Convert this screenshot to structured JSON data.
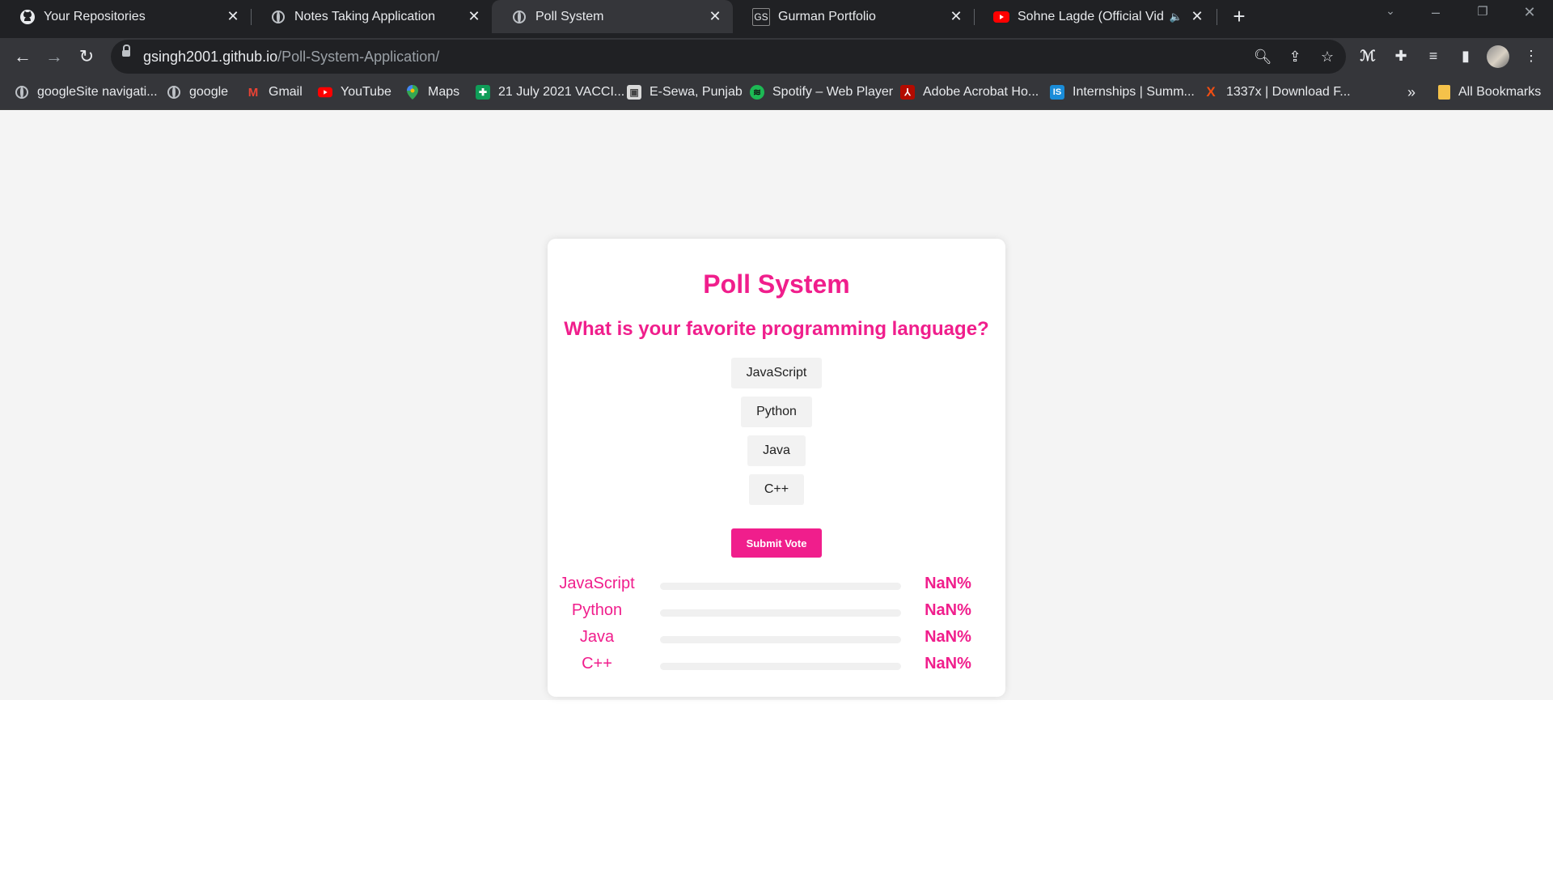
{
  "browser": {
    "tabs": [
      {
        "title": "Your Repositories",
        "icon": "github-icon"
      },
      {
        "title": "Notes Taking Application",
        "icon": "globe-icon"
      },
      {
        "title": "Poll System",
        "icon": "globe-icon",
        "active": true
      },
      {
        "title": "Gurman Portfolio",
        "icon": "gs-logo-icon",
        "favicon_text": "GS"
      },
      {
        "title": "Sohne Lagde (Official Video",
        "icon": "youtube-icon",
        "audio": "🔈"
      }
    ],
    "new_tab": "+",
    "url": {
      "host": "gsingh2001.github.io",
      "path": "/Poll-System-Application/"
    },
    "bookmarks": [
      {
        "label": "googleSite navigati...",
        "icon": "globe-icon"
      },
      {
        "label": "google",
        "icon": "globe-icon"
      },
      {
        "label": "Gmail",
        "icon": "gmail-icon",
        "glyph": "M"
      },
      {
        "label": "YouTube",
        "icon": "youtube-icon"
      },
      {
        "label": "Maps",
        "icon": "maps-icon"
      },
      {
        "label": "21 July 2021 VACCI...",
        "icon": "sheets-icon"
      },
      {
        "label": "E-Sewa, Punjab",
        "icon": "esewa-icon"
      },
      {
        "label": "Spotify – Web Player",
        "icon": "spotify-icon"
      },
      {
        "label": "Adobe Acrobat Ho...",
        "icon": "acrobat-icon"
      },
      {
        "label": "Internships | Summ...",
        "icon": "internshala-icon",
        "glyph": "IS"
      },
      {
        "label": "1337x | Download F...",
        "icon": "1337x-icon",
        "glyph": "X"
      }
    ],
    "bookmarks_overflow": "»",
    "all_bookmarks": "All Bookmarks"
  },
  "poll": {
    "title": "Poll System",
    "question": "What is your favorite programming language?",
    "options": [
      "JavaScript",
      "Python",
      "Java",
      "C++"
    ],
    "submit_label": "Submit Vote",
    "results": [
      {
        "label": "JavaScript",
        "percent_text": "NaN%",
        "fill": 0
      },
      {
        "label": "Python",
        "percent_text": "NaN%",
        "fill": 0
      },
      {
        "label": "Java",
        "percent_text": "NaN%",
        "fill": 0
      },
      {
        "label": "C++",
        "percent_text": "NaN%",
        "fill": 0
      }
    ]
  },
  "colors": {
    "accent": "#f01e8c",
    "page_bg": "#f4f4f4",
    "chrome_dark": "#202124",
    "chrome_toolbar": "#35363a"
  }
}
